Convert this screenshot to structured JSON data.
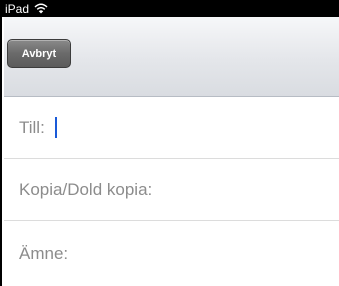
{
  "status_bar": {
    "device": "iPad",
    "wifi_icon": "wifi-icon"
  },
  "toolbar": {
    "cancel_label": "Avbryt"
  },
  "compose": {
    "to_label": "Till:",
    "to_value": "",
    "cc_label": "Kopia/Dold kopia:",
    "cc_value": "",
    "subject_label": "Ämne:",
    "subject_value": ""
  },
  "colors": {
    "caret": "#1a5ad8",
    "label_text": "#8c8c8c"
  }
}
